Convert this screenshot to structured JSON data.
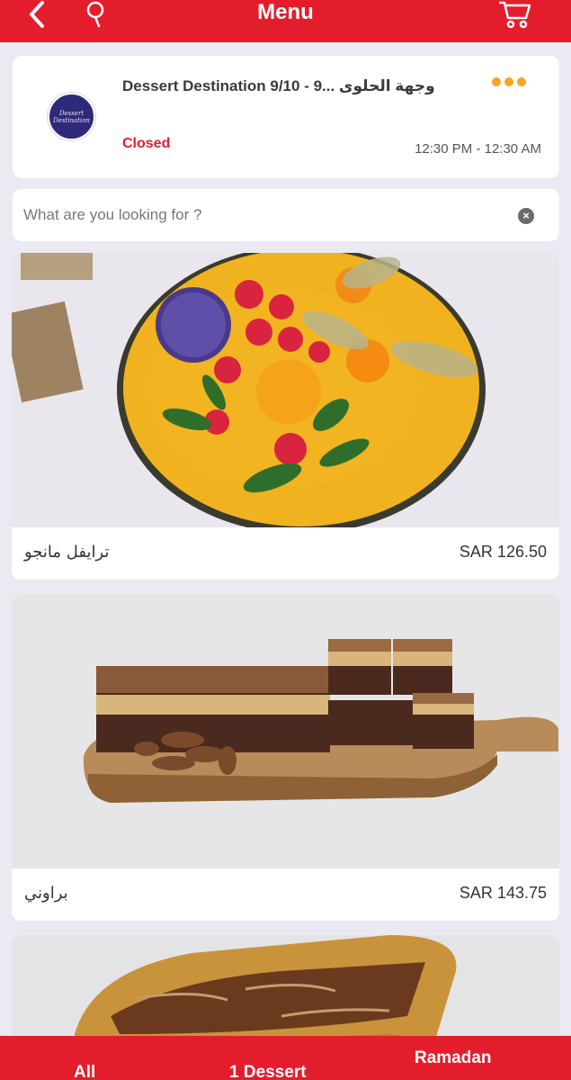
{
  "header": {
    "title": "Menu",
    "back_icon": "chevron-left-icon",
    "search_icon": "search-icon",
    "cart_icon": "cart-icon",
    "accent_color": "#e41d2c"
  },
  "restaurant": {
    "name": "Dessert Destination 9/10 - 9... وجهة الحلوى",
    "logo_text": "Dessert Destination",
    "status": "Closed",
    "hours": "12:30 PM - 12:30 AM",
    "more_icon": "more-dots-icon"
  },
  "search": {
    "placeholder": "What are you looking for ?",
    "clear_icon": "clear-icon"
  },
  "products": [
    {
      "name": "ترايفل مانجو",
      "price": "SAR 126.50"
    },
    {
      "name": "براوني",
      "price": "SAR 143.75"
    }
  ],
  "tabs": [
    {
      "label": "All"
    },
    {
      "label": "1 Dessert"
    },
    {
      "label": "Ramadan"
    }
  ]
}
